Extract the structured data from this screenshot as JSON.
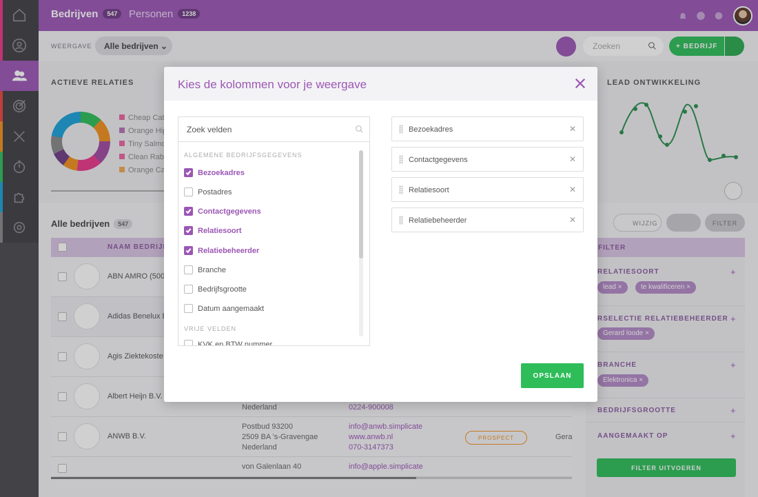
{
  "header": {
    "tabs": [
      {
        "label": "Bedrijven",
        "count": "547"
      },
      {
        "label": "Personen",
        "count": "1238"
      }
    ],
    "icons": [
      "bell-icon",
      "help-icon",
      "gear-icon"
    ]
  },
  "sidebar": {
    "icons": [
      "home-icon",
      "person-icon",
      "people-icon",
      "target-icon",
      "tools-icon",
      "stopwatch-icon",
      "puzzle-icon",
      "settings-icon"
    ],
    "active": "people-icon"
  },
  "toolbar": {
    "weergave_label": "WEERGAVE",
    "view_value": "Alle bedrijven",
    "search_placeholder": "Zoeken",
    "add_button": "BEDRIJF"
  },
  "background": {
    "actieve_relaties": "ACTIEVE RELATIES",
    "legend": [
      "Cheap Cat",
      "Orange Hip",
      "Tiny Salmo",
      "Clean Rabb",
      "Orange Ca"
    ],
    "lead_ontwikkeling": "LEAD ONTWIKKELING",
    "list_title": "Alle bedrijven",
    "list_count": "547",
    "col_name": "NAAM BEDRIJF",
    "rows": [
      "ABN AMRO (500",
      "Adidas Benelux B",
      "Agis Ziektekoste",
      "Albert Heijn B.V.",
      "ANWB B.V."
    ],
    "ah_addr": "Nederland",
    "ah_phone": "0224-900008",
    "anwb_addr": [
      "Postbud 93200",
      "2509 BA 's-Gravengae",
      "Nederland"
    ],
    "anwb_contact": [
      "info@anwb.simplicate",
      "www.anwb.nl",
      "070-3147373"
    ],
    "anwb_status": "PROSPECT",
    "anwb_owner": "Gera",
    "apple_addr": "von Galenlaan 40",
    "apple_contact": "info@apple.simplicate",
    "wijzig": "WIJZIG",
    "filter_btn": "FILTER",
    "filter_head": "FILTER",
    "filter_sections": [
      "RELATIESOORT",
      "RSELECTIE RELATIEBEHEERDER",
      "BRANCHE",
      "BEDRIJFSGROOTTE",
      "AANGEMAAKT OP"
    ],
    "chips": {
      "relatiesoort": [
        "lead",
        "te kwalificeren"
      ],
      "relatiebeheerder": [
        "Gerard loode"
      ],
      "branche": [
        "Elektronica"
      ]
    },
    "filter_run": "FILTER UITVOEREN"
  },
  "modal": {
    "title": "Kies de kolommen voor je weergave",
    "search_placeholder": "Zoek velden",
    "group_general": "ALGEMENE BEDRIJFSGEGEVENS",
    "group_free": "VRIJE VELDEN",
    "options": [
      {
        "label": "Bezoekadres",
        "checked": true
      },
      {
        "label": "Postadres",
        "checked": false
      },
      {
        "label": "Contactgegevens",
        "checked": true
      },
      {
        "label": "Relatiesoort",
        "checked": true
      },
      {
        "label": "Relatiebeheerder",
        "checked": true
      },
      {
        "label": "Branche",
        "checked": false
      },
      {
        "label": "Bedrijfsgrootte",
        "checked": false
      },
      {
        "label": "Datum aangemaakt",
        "checked": false
      }
    ],
    "free_options": [
      {
        "label": "KVK en BTW nummer",
        "checked": false
      }
    ],
    "selected": [
      "Bezoekadres",
      "Contactgegevens",
      "Relatiesoort",
      "Relatiebeheerder"
    ],
    "save": "OPSLAAN"
  },
  "colors": {
    "accent": "#9b57b5",
    "green": "#2ebd59",
    "orange": "#f0901d"
  }
}
